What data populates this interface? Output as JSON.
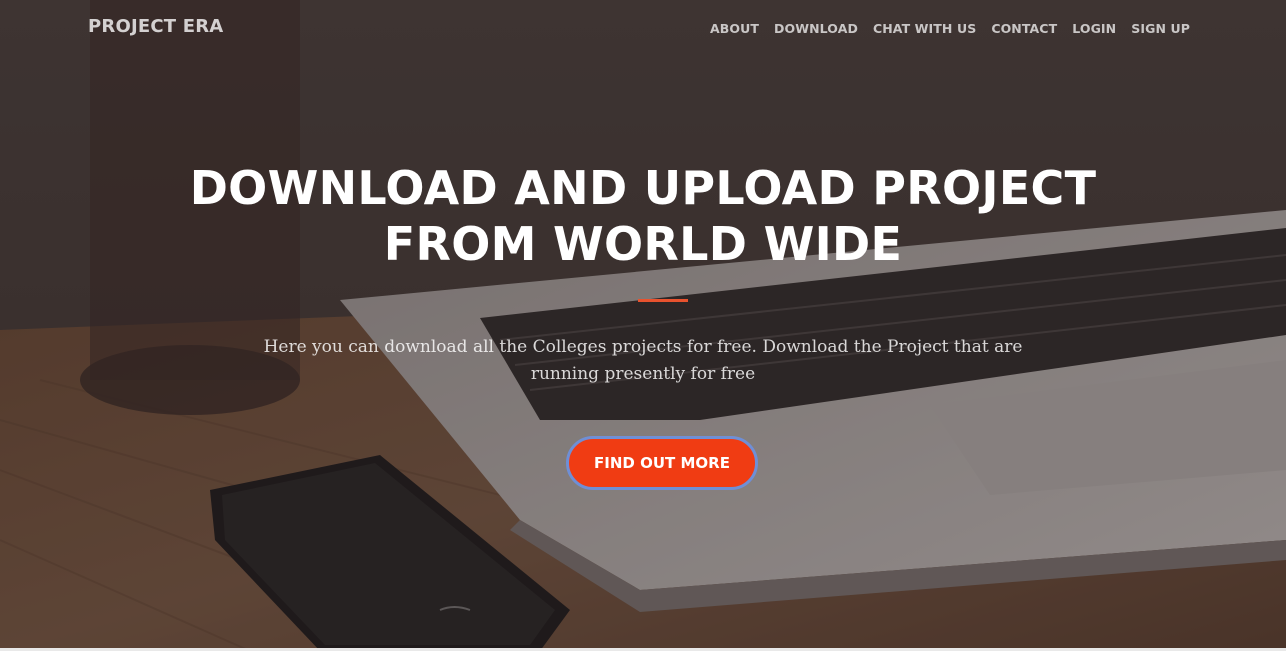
{
  "navbar": {
    "brand": "PROJECT ERA",
    "links": [
      "ABOUT",
      "DOWNLOAD",
      "CHAT WITH US",
      "CONTACT",
      "LOGIN",
      "SIGN UP"
    ]
  },
  "hero": {
    "headline_line1": "DOWNLOAD AND UPLOAD PROJECT",
    "headline_line2": "FROM WORLD WIDE",
    "subtext_line1": "Here you can download all the Colleges projects for free. Download the Project that are",
    "subtext_line2": "running presently for free",
    "cta_label": "FIND OUT MORE"
  },
  "colors": {
    "accent": "#f03c13",
    "divider": "#e8522e",
    "button_border": "#6f8fd6"
  }
}
